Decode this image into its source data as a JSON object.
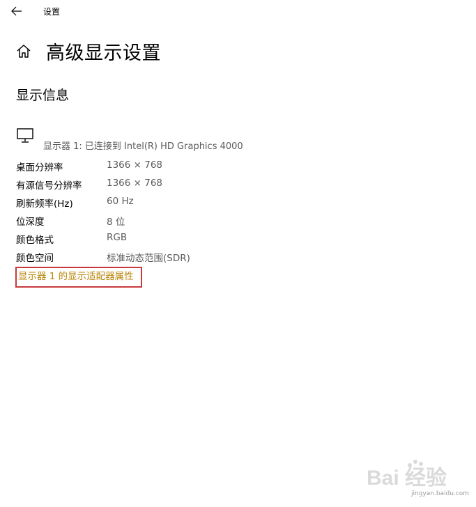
{
  "window": {
    "title": "设置",
    "back_icon": "arrow-left-icon"
  },
  "header": {
    "home_icon": "home-icon",
    "title": "高级显示设置"
  },
  "section": {
    "title": "显示信息",
    "monitor_icon": "monitor-icon",
    "display_description": "显示器 1: 已连接到 Intel(R) HD Graphics 4000"
  },
  "info_rows": [
    {
      "label": "桌面分辨率",
      "value": "1366 × 768"
    },
    {
      "label": "有源信号分辨率",
      "value": "1366 × 768"
    },
    {
      "label": "刷新频率(Hz)",
      "value": "60 Hz"
    },
    {
      "label": "位深度",
      "value": "8 位"
    },
    {
      "label": "颜色格式",
      "value": "RGB"
    },
    {
      "label": "颜色空间",
      "value": "标准动态范围(SDR)"
    }
  ],
  "adapter_link": {
    "label": "显示器 1 的显示适配器属性"
  },
  "watermark": {
    "logo": "Bai 经验",
    "sub": "jingyan.baidu.com"
  },
  "colors": {
    "link": "#b8860b",
    "highlight_border": "#c8393b",
    "secondary_text": "#5a5a5a"
  }
}
